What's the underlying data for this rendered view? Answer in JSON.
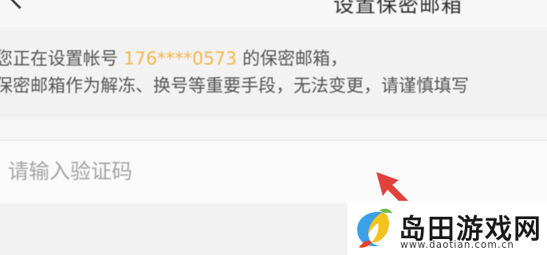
{
  "nav": {
    "title": "设置保密邮箱"
  },
  "info": {
    "line1_prefix": "您正在设置帐号 ",
    "account": "176****0573",
    "line1_suffix": " 的保密邮箱，",
    "line2": "保密邮箱作为解冻、换号等重要手段，无法变更，请谨慎填写"
  },
  "input": {
    "placeholder": "请输入验证码",
    "value": ""
  },
  "colors": {
    "account_highlight": "#f1b84a",
    "arrow": "#e0312b"
  },
  "watermark": {
    "name": "岛田游戏网",
    "url": "www.daotian.com.cn"
  }
}
